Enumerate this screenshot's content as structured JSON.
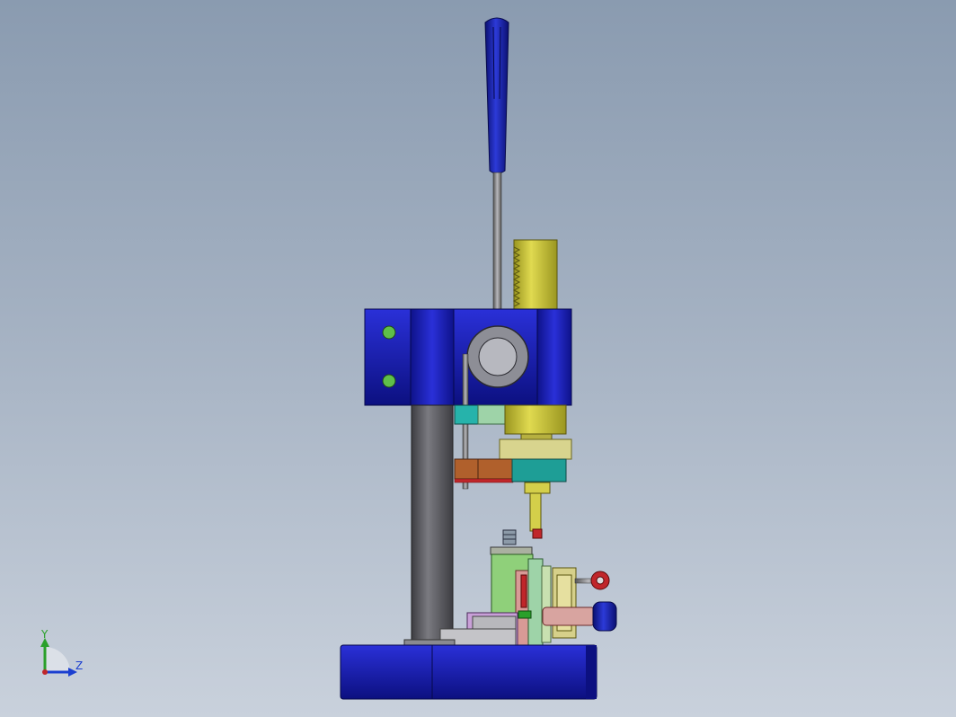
{
  "viewport": {
    "background_top": "#8a9bb0",
    "background_bottom": "#c9d1dc"
  },
  "model": {
    "colors": {
      "blue": "#1a1fb8",
      "blue_dark": "#0c1080",
      "yellow": "#c9c43a",
      "gray_column": "#5c5c60",
      "teal": "#26a39b",
      "brown": "#a55a2a",
      "green": "#8fd07a",
      "pink": "#d89a96",
      "red": "#c0262a",
      "olive": "#d6d08a"
    }
  },
  "triad": {
    "y_label": "Y",
    "z_label": "Z",
    "y_color": "#2aa02a",
    "z_color": "#1b3fd0"
  }
}
